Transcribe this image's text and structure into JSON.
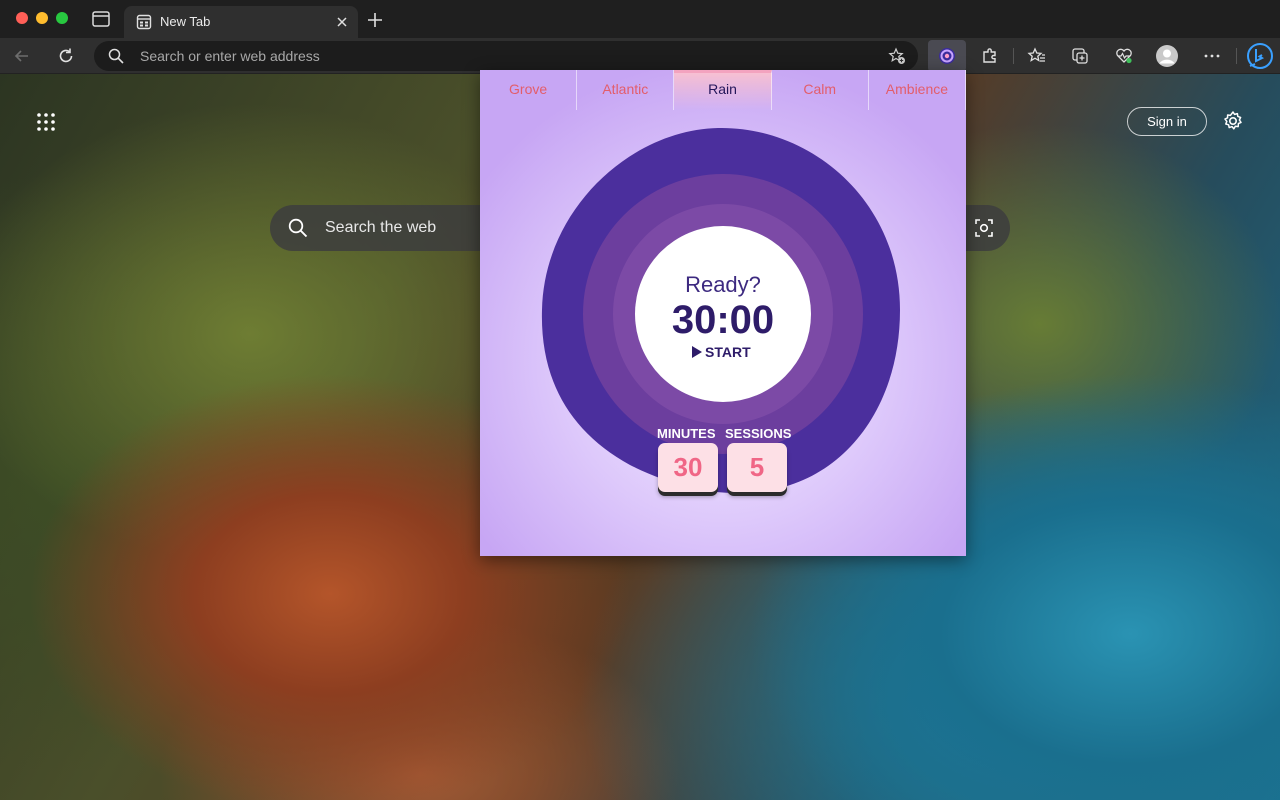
{
  "browser": {
    "tab_title": "New Tab",
    "address_placeholder": "Search or enter web address"
  },
  "newtab": {
    "search_placeholder": "Search the web",
    "signin_label": "Sign in"
  },
  "popup": {
    "tabs": [
      {
        "label": "Grove",
        "active": false
      },
      {
        "label": "Atlantic",
        "active": false
      },
      {
        "label": "Rain",
        "active": true
      },
      {
        "label": "Calm",
        "active": false
      },
      {
        "label": "Ambience",
        "active": false
      }
    ],
    "status_text": "Ready?",
    "timer": "30:00",
    "start_label": "START",
    "minutes_label": "MINUTES",
    "sessions_label": "SESSIONS",
    "minutes_value": "30",
    "sessions_value": "5"
  },
  "colors": {
    "accent_pink": "#e35d6a",
    "dark_purple": "#2e1c69",
    "ring_purple": "#4c2f9e"
  },
  "icons": [
    "tab-actions-icon",
    "new-tab-favicon",
    "close-icon",
    "plus-icon",
    "back-arrow-icon",
    "refresh-icon",
    "search-icon",
    "favorite-add-icon",
    "extension-icon",
    "puzzle-icon",
    "favorites-icon",
    "collections-icon",
    "health-icon",
    "profile-icon",
    "more-icon",
    "bing-icon",
    "apps-grid-icon",
    "settings-gear-icon",
    "visual-search-icon",
    "play-icon"
  ]
}
